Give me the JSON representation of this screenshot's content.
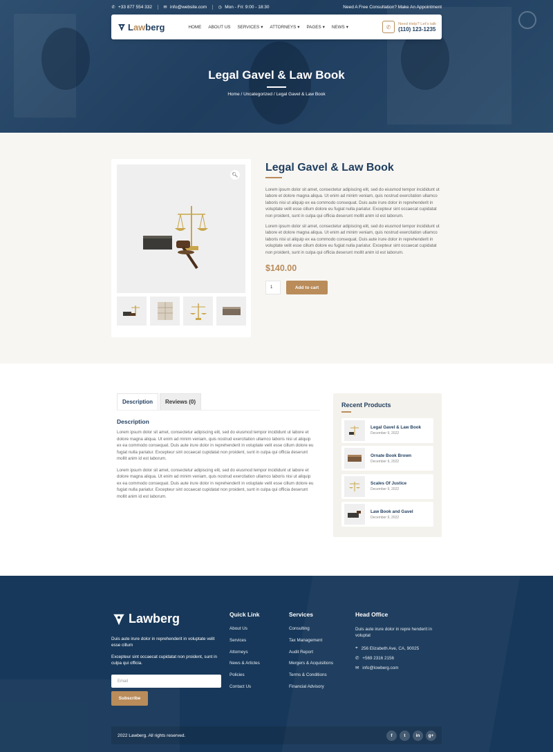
{
  "topbar": {
    "phone": "+33 877 554 332",
    "email": "info@website.com",
    "hours": "Mon - Fri: 9:00 - 18:30",
    "cta": "Need A Free Consultation? Make An Appointment"
  },
  "brand": {
    "name_a": "L",
    "name_b": "aw",
    "name_c": "berg",
    "footer_name": "Lawberg"
  },
  "nav": {
    "items": [
      {
        "label": "HOME",
        "dropdown": false
      },
      {
        "label": "ABOUT US",
        "dropdown": false
      },
      {
        "label": "SERVICES",
        "dropdown": true
      },
      {
        "label": "ATTORNEYS",
        "dropdown": true
      },
      {
        "label": "PAGES",
        "dropdown": true
      },
      {
        "label": "NEWS",
        "dropdown": true
      }
    ],
    "help_label": "Need Help? Let's talk",
    "help_phone": "(110) 123-1235"
  },
  "hero": {
    "title": "Legal Gavel & Law Book",
    "breadcrumb": "Home / Uncategorized / Legal Gavel & Law Book"
  },
  "product": {
    "title": "Legal Gavel & Law Book",
    "paragraphs": [
      "Lorem ipsum dolor sit amet, consectetur adipiscing elit, sed do eiusmod tempor incididunt ut labore et dolore magna aliqua. Ut enim ad minim veniam, quis nostrud exercitation ullamco laboris nisi ut aliquip ex ea commodo consequat. Duis aute irure dolor in reprehenderit in voluptate velit esse cillum dolore eu fugiat nulla pariatur. Excepteur sint occaecat cupidatat non proident, sunt in culpa qui officia deserunt mollit anim id est laborum.",
      "Lorem ipsum dolor sit amet, consectetur adipiscing elit, sed do eiusmod tempor incididunt ut labore et dolore magna aliqua. Ut enim ad minim veniam, quis nostrud exercitation ullamco laboris nisi ut aliquip ex ea commodo consequat. Duis aute irure dolor in reprehenderit in voluptate velit esse cillum dolore eu fugiat nulla pariatur. Excepteur sint occaecat cupidatat non proident, sunt in culpa qui officia deserunt mollit anim id est laborum."
    ],
    "price": "$140.00",
    "quantity": "1",
    "add_to_cart": "Add to cart"
  },
  "tabs": {
    "description": "Description",
    "reviews": "Reviews (0)"
  },
  "description": {
    "heading": "Description",
    "paragraphs": [
      "Lorem ipsum dolor sit amet, consectetur adipiscing elit, sed do eiusmod tempor incididunt ut labore et dolore magna aliqua. Ut enim ad minim veniam, quis nostrud exercitation ullamco laboris nisi ut aliquip ex ea commodo consequat. Duis aute irure dolor in reprehenderit in voluptate velit esse cillum dolore eu fugiat nulla pariatur. Excepteur sint occaecat cupidatat non proident, sunt in culpa qui officia deserunt mollit anim id est laborum.",
      "Lorem ipsum dolor sit amet, consectetur adipiscing elit, sed do eiusmod tempor incididunt ut labore et dolore magna aliqua. Ut enim ad minim veniam, quis nostrud exercitation ullamco laboris nisi ut aliquip ex ea commodo consequat. Duis aute irure dolor in reprehenderit in voluptate velit esse cillum dolore eu fugiat nulla pariatur. Excepteur sint occaecat cupidatat non proident, sunt in culpa qui officia deserunt mollit anim id est laborum."
    ]
  },
  "recent": {
    "heading": "Recent Products",
    "items": [
      {
        "name": "Legal Gavel & Law Book",
        "date": "December 9, 2022",
        "icon": "scales-icon"
      },
      {
        "name": "Ornate Book Brown",
        "date": "December 9, 2022",
        "icon": "book-icon"
      },
      {
        "name": "Scales Of Justice",
        "date": "December 9, 2022",
        "icon": "scales-icon"
      },
      {
        "name": "Law Book and Gavel",
        "date": "December 9, 2022",
        "icon": "book-icon"
      }
    ]
  },
  "footer": {
    "about_1": "Duis aute irure dolor in reprehenderit in voluptate velit esse cillum",
    "about_2": "Excepteur sint occaecat cupidatat non proident, sunt in culpa qui officia.",
    "email_placeholder": "Email",
    "subscribe": "Subscribe",
    "quick_link": {
      "heading": "Quick Link",
      "items": [
        "About Us",
        "Services",
        "Attorneys",
        "News & Articles",
        "Policies",
        "Contact Us"
      ]
    },
    "services": {
      "heading": "Services",
      "items": [
        "Consulting",
        "Tax Management",
        "Audit Report",
        "Mergers & Acquisitions",
        "Terms & Conditions",
        "Financial Advisory"
      ]
    },
    "head_office": {
      "heading": "Head Office",
      "text": "Duis aute irure dolor in repre henderit in voluptat",
      "address": "256 Elizabeth Ave, CA, 90025",
      "phone": "+569 2316 2156",
      "email": "info@lowberg.com"
    },
    "copyright": "2022 Lawberg. All rights reserved.",
    "socials": [
      "f",
      "t",
      "in",
      "g+"
    ]
  },
  "colors": {
    "navy": "#1f3d5e",
    "gold": "#b98c5a",
    "footer": "#17385a"
  }
}
